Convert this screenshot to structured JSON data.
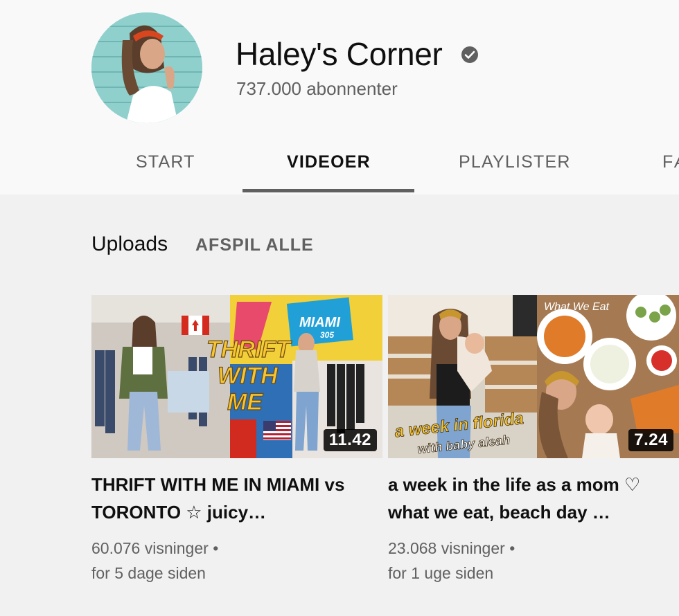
{
  "channel": {
    "name": "Haley's Corner",
    "subscribers": "737.000 abonnenter",
    "verified": true
  },
  "tabs": [
    {
      "label": "START",
      "active": false
    },
    {
      "label": "VIDEOER",
      "active": true
    },
    {
      "label": "PLAYLISTER",
      "active": false
    },
    {
      "label": "FÆ",
      "active": false
    }
  ],
  "section": {
    "title": "Uploads",
    "play_all": "AFSPIL ALLE"
  },
  "videos": [
    {
      "title": "THRIFT WITH ME IN MIAMI vs TORONTO ☆ juicy…",
      "duration": "11.42",
      "views": "60.076 visninger",
      "age": "for 5 dage siden",
      "thumb_text": {
        "line1": "THRIFT",
        "line2": "WITH",
        "line3": "ME",
        "sign": "MIAMI",
        "sign2": "305"
      }
    },
    {
      "title": "a week in the life as a mom ♡ what we eat, beach day …",
      "duration": "7.24",
      "views": "23.068 visninger",
      "age": "for 1 uge siden",
      "thumb_text": {
        "line1": "a week in florida",
        "line2": "with baby aleah",
        "corner": "What We Eat"
      }
    }
  ],
  "meta_separator": "•",
  "colors": {
    "accent_underline": "#606060",
    "text_primary": "#0f0f0f",
    "text_secondary": "#606060"
  }
}
